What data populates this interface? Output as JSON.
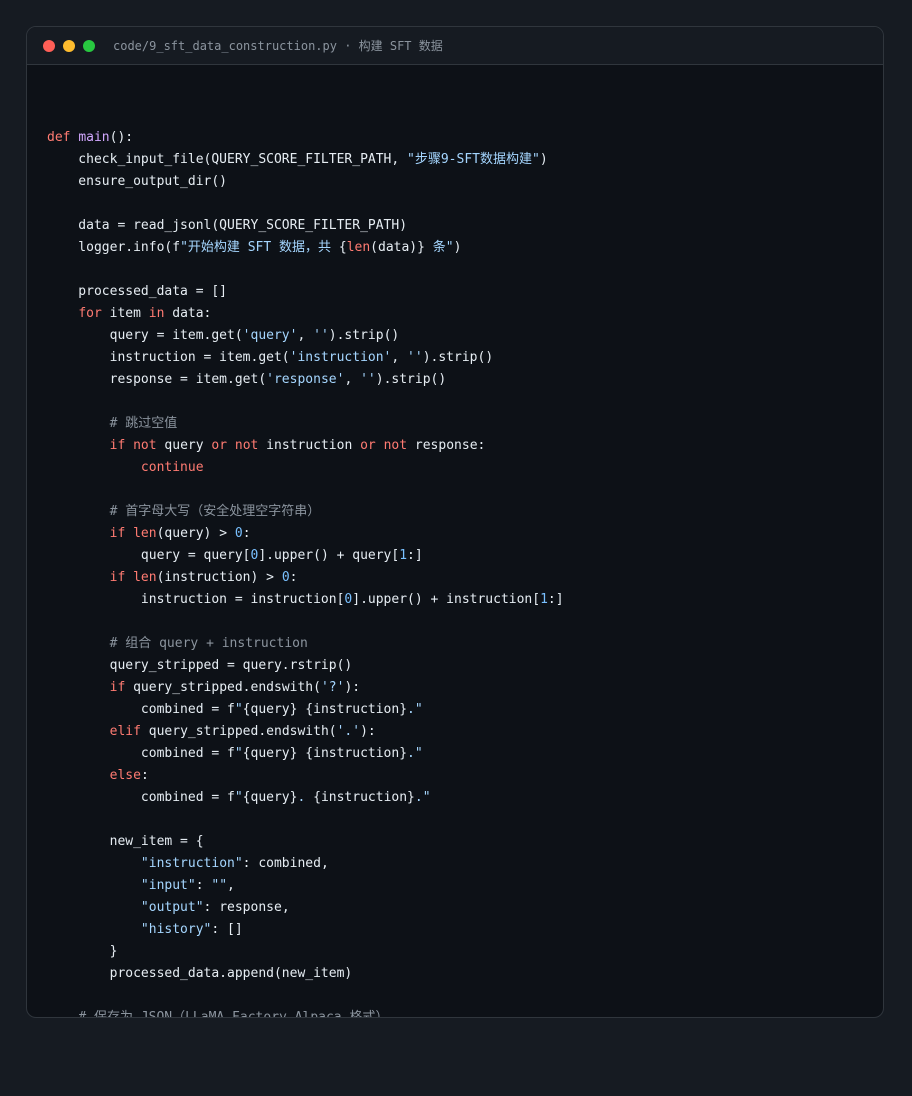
{
  "window": {
    "title": "code/9_sft_data_construction.py · 构建 SFT 数据",
    "traffic_lights": [
      {
        "name": "close",
        "color": "#ff5f57"
      },
      {
        "name": "minimize",
        "color": "#febc2e"
      },
      {
        "name": "zoom",
        "color": "#28c840"
      }
    ]
  },
  "colors": {
    "keyword": "#ff7b72",
    "function": "#d2a8ff",
    "string": "#a5d6ff",
    "number": "#79c0ff",
    "comment": "#8b949e",
    "text": "#e6edf3",
    "background": "#0d1117"
  },
  "code": {
    "lines": [
      [],
      [
        {
          "t": "kw",
          "v": "def"
        },
        {
          "t": "nm",
          "v": " "
        },
        {
          "t": "fn",
          "v": "main"
        },
        {
          "t": "nm",
          "v": "():"
        }
      ],
      [
        {
          "t": "nm",
          "v": "    check_input_file(QUERY_SCORE_FILTER_PATH, "
        },
        {
          "t": "str",
          "v": "\"步骤9-SFT数据构建\""
        },
        {
          "t": "nm",
          "v": ")"
        }
      ],
      [
        {
          "t": "nm",
          "v": "    ensure_output_dir()"
        }
      ],
      [],
      [
        {
          "t": "nm",
          "v": "    data = read_jsonl(QUERY_SCORE_FILTER_PATH)"
        }
      ],
      [
        {
          "t": "nm",
          "v": "    logger.info(f"
        },
        {
          "t": "str",
          "v": "\"开始构建 SFT 数据，共 "
        },
        {
          "t": "nm",
          "v": "{"
        },
        {
          "t": "kw",
          "v": "len"
        },
        {
          "t": "nm",
          "v": "(data)}"
        },
        {
          "t": "str",
          "v": " 条\""
        },
        {
          "t": "nm",
          "v": ")"
        }
      ],
      [],
      [
        {
          "t": "nm",
          "v": "    processed_data = []"
        }
      ],
      [
        {
          "t": "nm",
          "v": "    "
        },
        {
          "t": "kw",
          "v": "for"
        },
        {
          "t": "nm",
          "v": " item "
        },
        {
          "t": "kw",
          "v": "in"
        },
        {
          "t": "nm",
          "v": " data:"
        }
      ],
      [
        {
          "t": "nm",
          "v": "        query = item.get("
        },
        {
          "t": "str",
          "v": "'query'"
        },
        {
          "t": "nm",
          "v": ", "
        },
        {
          "t": "str",
          "v": "''"
        },
        {
          "t": "nm",
          "v": ").strip()"
        }
      ],
      [
        {
          "t": "nm",
          "v": "        instruction = item.get("
        },
        {
          "t": "str",
          "v": "'instruction'"
        },
        {
          "t": "nm",
          "v": ", "
        },
        {
          "t": "str",
          "v": "''"
        },
        {
          "t": "nm",
          "v": ").strip()"
        }
      ],
      [
        {
          "t": "nm",
          "v": "        response = item.get("
        },
        {
          "t": "str",
          "v": "'response'"
        },
        {
          "t": "nm",
          "v": ", "
        },
        {
          "t": "str",
          "v": "''"
        },
        {
          "t": "nm",
          "v": ").strip()"
        }
      ],
      [],
      [
        {
          "t": "nm",
          "v": "        "
        },
        {
          "t": "cm",
          "v": "# 跳过空值"
        }
      ],
      [
        {
          "t": "nm",
          "v": "        "
        },
        {
          "t": "kw",
          "v": "if"
        },
        {
          "t": "nm",
          "v": " "
        },
        {
          "t": "kw",
          "v": "not"
        },
        {
          "t": "nm",
          "v": " query "
        },
        {
          "t": "kw",
          "v": "or"
        },
        {
          "t": "nm",
          "v": " "
        },
        {
          "t": "kw",
          "v": "not"
        },
        {
          "t": "nm",
          "v": " instruction "
        },
        {
          "t": "kw",
          "v": "or"
        },
        {
          "t": "nm",
          "v": " "
        },
        {
          "t": "kw",
          "v": "not"
        },
        {
          "t": "nm",
          "v": " response:"
        }
      ],
      [
        {
          "t": "nm",
          "v": "            "
        },
        {
          "t": "kw",
          "v": "continue"
        }
      ],
      [],
      [
        {
          "t": "nm",
          "v": "        "
        },
        {
          "t": "cm",
          "v": "# 首字母大写（安全处理空字符串）"
        }
      ],
      [
        {
          "t": "nm",
          "v": "        "
        },
        {
          "t": "kw",
          "v": "if"
        },
        {
          "t": "nm",
          "v": " "
        },
        {
          "t": "kw",
          "v": "len"
        },
        {
          "t": "nm",
          "v": "(query) > "
        },
        {
          "t": "num",
          "v": "0"
        },
        {
          "t": "nm",
          "v": ":"
        }
      ],
      [
        {
          "t": "nm",
          "v": "            query = query["
        },
        {
          "t": "num",
          "v": "0"
        },
        {
          "t": "nm",
          "v": "].upper() + query["
        },
        {
          "t": "num",
          "v": "1"
        },
        {
          "t": "nm",
          "v": ":]"
        }
      ],
      [
        {
          "t": "nm",
          "v": "        "
        },
        {
          "t": "kw",
          "v": "if"
        },
        {
          "t": "nm",
          "v": " "
        },
        {
          "t": "kw",
          "v": "len"
        },
        {
          "t": "nm",
          "v": "(instruction) > "
        },
        {
          "t": "num",
          "v": "0"
        },
        {
          "t": "nm",
          "v": ":"
        }
      ],
      [
        {
          "t": "nm",
          "v": "            instruction = instruction["
        },
        {
          "t": "num",
          "v": "0"
        },
        {
          "t": "nm",
          "v": "].upper() + instruction["
        },
        {
          "t": "num",
          "v": "1"
        },
        {
          "t": "nm",
          "v": ":]"
        }
      ],
      [],
      [
        {
          "t": "nm",
          "v": "        "
        },
        {
          "t": "cm",
          "v": "# 组合 query + instruction"
        }
      ],
      [
        {
          "t": "nm",
          "v": "        query_stripped = query.rstrip()"
        }
      ],
      [
        {
          "t": "nm",
          "v": "        "
        },
        {
          "t": "kw",
          "v": "if"
        },
        {
          "t": "nm",
          "v": " query_stripped.endswith("
        },
        {
          "t": "str",
          "v": "'?'"
        },
        {
          "t": "nm",
          "v": "):"
        }
      ],
      [
        {
          "t": "nm",
          "v": "            combined = f"
        },
        {
          "t": "str",
          "v": "\""
        },
        {
          "t": "nm",
          "v": "{query} {instruction}"
        },
        {
          "t": "str",
          "v": ".\""
        }
      ],
      [
        {
          "t": "nm",
          "v": "        "
        },
        {
          "t": "kw",
          "v": "elif"
        },
        {
          "t": "nm",
          "v": " query_stripped.endswith("
        },
        {
          "t": "str",
          "v": "'.'"
        },
        {
          "t": "nm",
          "v": "):"
        }
      ],
      [
        {
          "t": "nm",
          "v": "            combined = f"
        },
        {
          "t": "str",
          "v": "\""
        },
        {
          "t": "nm",
          "v": "{query} {instruction}"
        },
        {
          "t": "str",
          "v": ".\""
        }
      ],
      [
        {
          "t": "nm",
          "v": "        "
        },
        {
          "t": "kw",
          "v": "else"
        },
        {
          "t": "nm",
          "v": ":"
        }
      ],
      [
        {
          "t": "nm",
          "v": "            combined = f"
        },
        {
          "t": "str",
          "v": "\""
        },
        {
          "t": "nm",
          "v": "{query}"
        },
        {
          "t": "str",
          "v": ". "
        },
        {
          "t": "nm",
          "v": "{instruction}"
        },
        {
          "t": "str",
          "v": ".\""
        }
      ],
      [],
      [
        {
          "t": "nm",
          "v": "        new_item = {"
        }
      ],
      [
        {
          "t": "nm",
          "v": "            "
        },
        {
          "t": "str",
          "v": "\"instruction\""
        },
        {
          "t": "nm",
          "v": ": combined,"
        }
      ],
      [
        {
          "t": "nm",
          "v": "            "
        },
        {
          "t": "str",
          "v": "\"input\""
        },
        {
          "t": "nm",
          "v": ": "
        },
        {
          "t": "str",
          "v": "\"\""
        },
        {
          "t": "nm",
          "v": ","
        }
      ],
      [
        {
          "t": "nm",
          "v": "            "
        },
        {
          "t": "str",
          "v": "\"output\""
        },
        {
          "t": "nm",
          "v": ": response,"
        }
      ],
      [
        {
          "t": "nm",
          "v": "            "
        },
        {
          "t": "str",
          "v": "\"history\""
        },
        {
          "t": "nm",
          "v": ": []"
        }
      ],
      [
        {
          "t": "nm",
          "v": "        }"
        }
      ],
      [
        {
          "t": "nm",
          "v": "        processed_data.append(new_item)"
        }
      ],
      [],
      [
        {
          "t": "nm",
          "v": "    "
        },
        {
          "t": "cm",
          "v": "# 保存为 JSON（LLaMA Factory Alpaca 格式）"
        }
      ]
    ]
  }
}
